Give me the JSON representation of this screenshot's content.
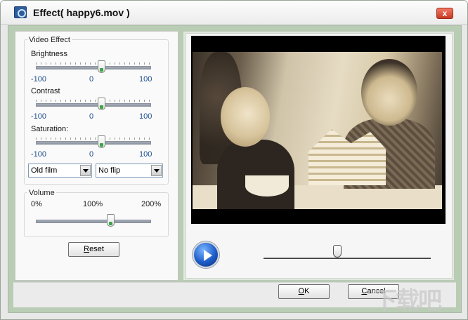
{
  "window": {
    "title": "Effect( happy6.mov )",
    "close_label": "x"
  },
  "video_effect": {
    "group_label": "Video Effect",
    "sliders": [
      {
        "label": "Brightness",
        "min": "-100",
        "mid": "0",
        "max": "100",
        "value": 15
      },
      {
        "label": "Contrast",
        "min": "-100",
        "mid": "0",
        "max": "100",
        "value": 15
      },
      {
        "label": "Saturation:",
        "min": "-100",
        "mid": "0",
        "max": "100",
        "value": 15
      }
    ],
    "effect_select": {
      "value": "Old film"
    },
    "flip_select": {
      "value": "No flip"
    }
  },
  "volume": {
    "group_label": "Volume",
    "min": "0%",
    "mid": "100%",
    "max": "200%",
    "value_percent": 130
  },
  "reset_button": {
    "prefix": "",
    "underlined": "R",
    "rest": "eset"
  },
  "player": {
    "seek_fraction": 0.44
  },
  "footer": {
    "ok": {
      "underlined": "O",
      "rest": "K"
    },
    "cancel": {
      "underlined": "C",
      "rest": "ancel"
    }
  },
  "watermark_text": "下载吧"
}
